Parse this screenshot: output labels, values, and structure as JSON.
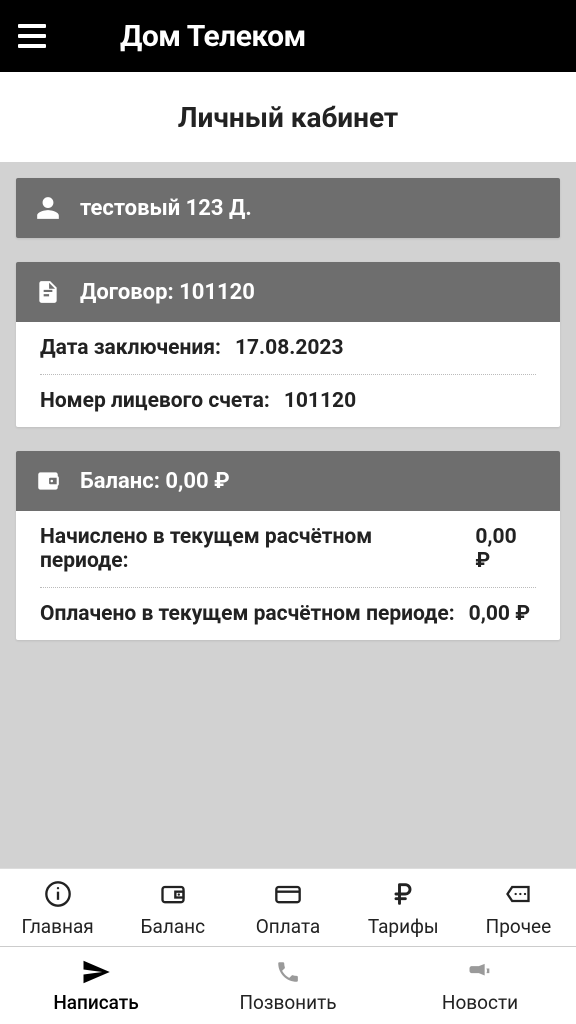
{
  "header": {
    "title": "Дом Телеком"
  },
  "subheader": {
    "title": "Личный кабинет"
  },
  "user": {
    "name": "тестовый 123 Д."
  },
  "contract": {
    "header": "Договор: 101120",
    "date_label": "Дата заключения:",
    "date_value": "17.08.2023",
    "account_label": "Номер лицевого счета:",
    "account_value": "101120"
  },
  "balance": {
    "header": "Баланс: 0,00 ₽",
    "charged_label": "Начислено в текущем расчётном периоде:",
    "charged_value": "0,00 ₽",
    "paid_label": "Оплачено в текущем расчётном периоде:",
    "paid_value": "0,00 ₽"
  },
  "nav": {
    "primary": [
      {
        "label": "Главная"
      },
      {
        "label": "Баланс"
      },
      {
        "label": "Оплата"
      },
      {
        "label": "Тарифы"
      },
      {
        "label": "Прочее"
      }
    ],
    "secondary": [
      {
        "label": "Написать"
      },
      {
        "label": "Позвонить"
      },
      {
        "label": "Новости"
      }
    ]
  }
}
